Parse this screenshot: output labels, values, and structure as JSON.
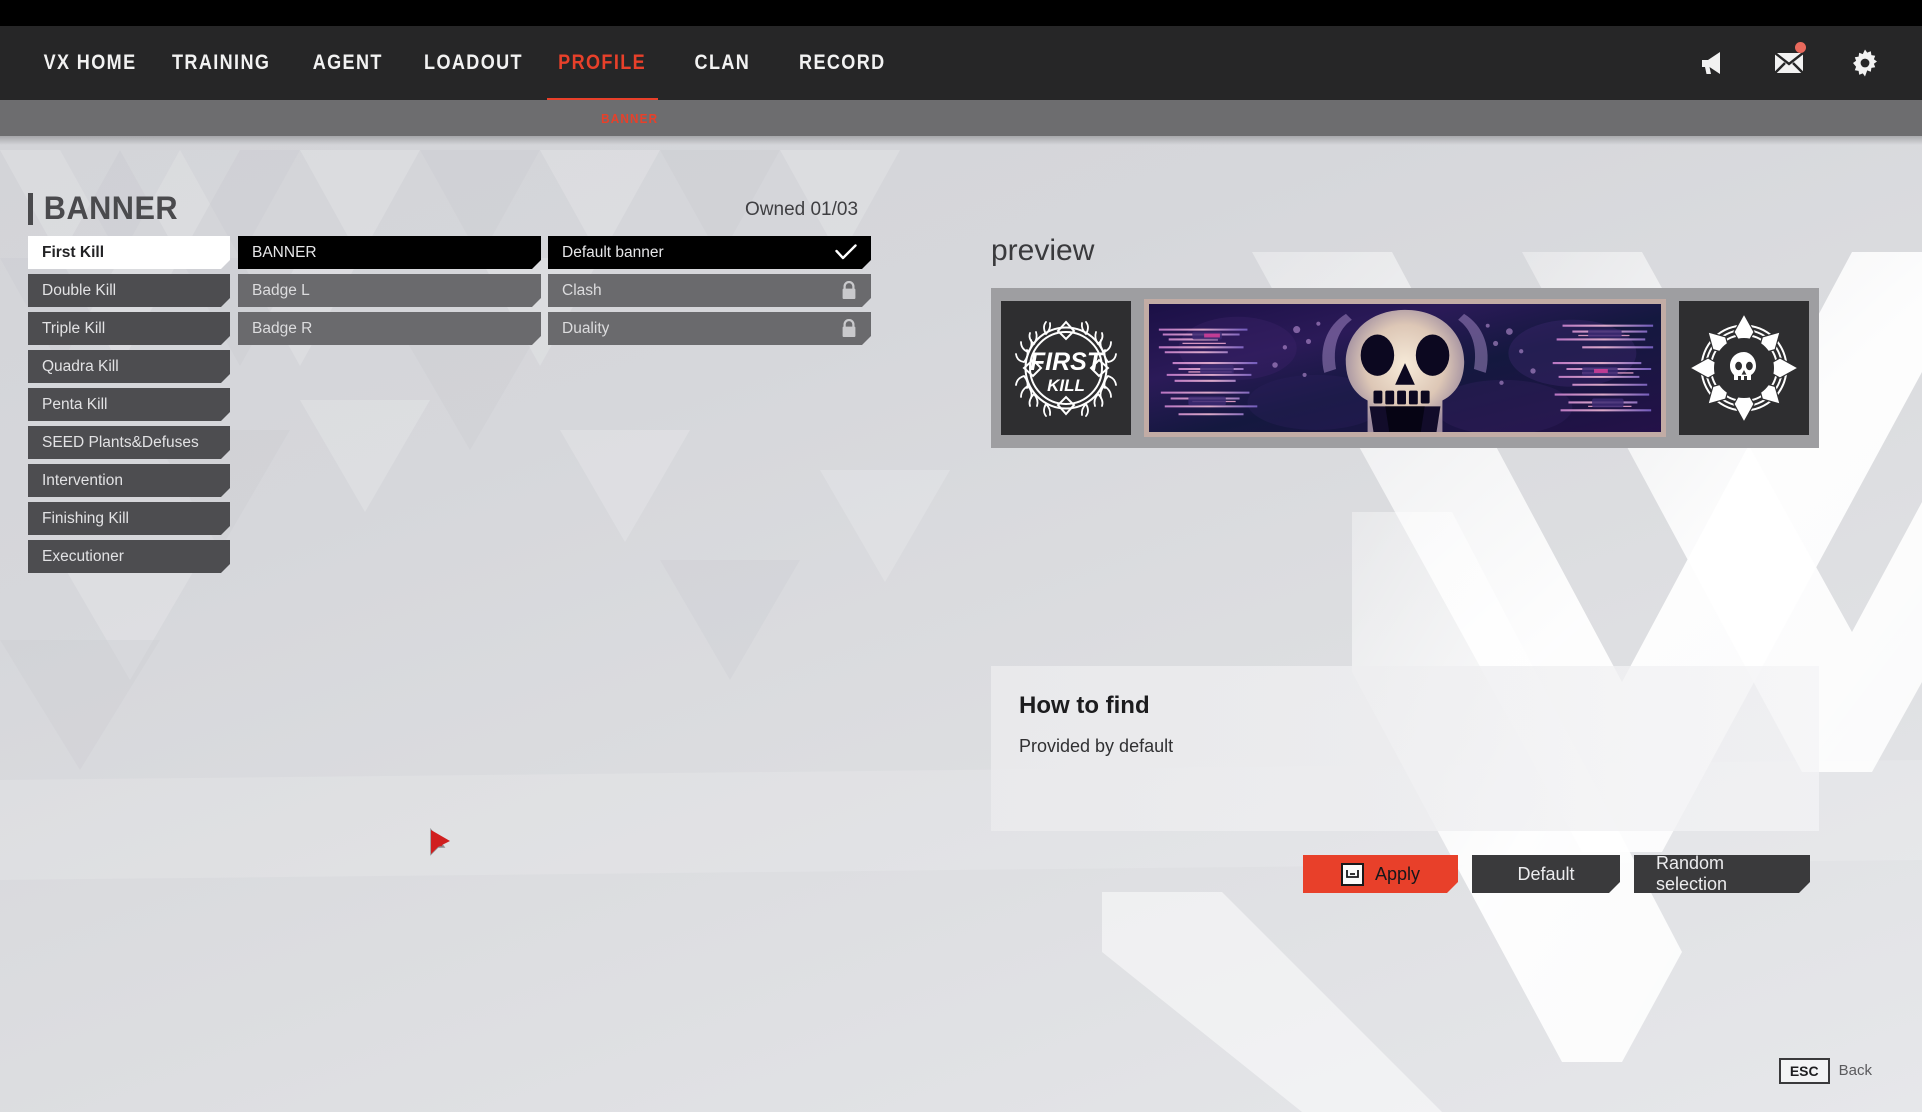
{
  "nav": {
    "items": [
      {
        "label": "VX HOME",
        "active": false
      },
      {
        "label": "TRAINING",
        "active": false
      },
      {
        "label": "AGENT",
        "active": false
      },
      {
        "label": "LOADOUT",
        "active": false
      },
      {
        "label": "PROFILE",
        "active": true
      },
      {
        "label": "CLAN",
        "active": false
      },
      {
        "label": "RECORD",
        "active": false
      }
    ],
    "icons": [
      {
        "name": "megaphone-icon",
        "has_notification": false
      },
      {
        "name": "mail-icon",
        "has_notification": true
      },
      {
        "name": "gear-icon",
        "has_notification": false
      }
    ],
    "accent_color": "#e8402a",
    "notification_dot_color": "#e8695c"
  },
  "subnav": {
    "tab_label": "BANNER"
  },
  "header": {
    "page_title": "BANNER",
    "owned_label": "Owned 01/03"
  },
  "columns": {
    "category": [
      {
        "label": "First Kill",
        "state": "selected-white"
      },
      {
        "label": "Double Kill",
        "state": "normal"
      },
      {
        "label": "Triple Kill",
        "state": "normal"
      },
      {
        "label": "Quadra Kill",
        "state": "normal"
      },
      {
        "label": "Penta Kill",
        "state": "normal"
      },
      {
        "label": "SEED Plants&Defuses",
        "state": "normal"
      },
      {
        "label": "Intervention",
        "state": "normal"
      },
      {
        "label": "Finishing Kill",
        "state": "normal"
      },
      {
        "label": "Executioner",
        "state": "normal"
      }
    ],
    "slot": [
      {
        "label": "BANNER",
        "state": "selected-black"
      },
      {
        "label": "Badge L",
        "state": "dim"
      },
      {
        "label": "Badge R",
        "state": "dim"
      }
    ],
    "item": [
      {
        "label": "Default banner",
        "state": "selected-black",
        "icon": "check-icon"
      },
      {
        "label": "Clash",
        "state": "dim",
        "icon": "lock-icon"
      },
      {
        "label": "Duality",
        "state": "dim",
        "icon": "lock-icon"
      }
    ]
  },
  "preview": {
    "heading": "preview",
    "badge_left": {
      "name": "first-kill-wreath-badge",
      "line1": "FIRST",
      "line2": "KILL"
    },
    "banner_art": {
      "name": "skull-banner-art"
    },
    "badge_right": {
      "name": "skull-rosette-badge"
    }
  },
  "howto": {
    "title": "How to find",
    "body": "Provided by default"
  },
  "actions": [
    {
      "label": "Apply",
      "style": "primary",
      "icon": "keyboard-key-icon"
    },
    {
      "label": "Default",
      "style": "secondary",
      "icon": ""
    },
    {
      "label": "Random selection",
      "style": "secondary",
      "icon": ""
    }
  ],
  "footer": {
    "esc_key": "ESC",
    "esc_label": "Back"
  }
}
